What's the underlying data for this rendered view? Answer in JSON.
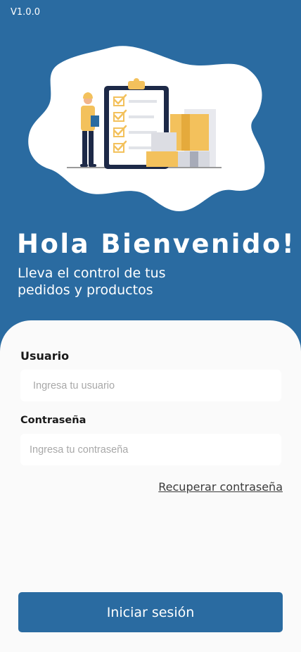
{
  "app": {
    "version": "V1.0.0"
  },
  "hero": {
    "title": "Hola Bienvenido!",
    "subtitle": "Lleva el control de tus pedidos y productos",
    "illustration_icon": "warehouse-checklist-illustration"
  },
  "form": {
    "user_label": "Usuario",
    "user_placeholder": "Ingresa tu usuario",
    "user_value": "",
    "password_label": "Contraseña",
    "password_placeholder": "Ingresa tu contraseña",
    "password_value": "",
    "recover_label": "Recuperar contraseña",
    "login_label": "Iniciar sesión"
  },
  "colors": {
    "primary": "#2a6ba1",
    "card": "#fafafa",
    "accent_yellow": "#f3c15c"
  }
}
